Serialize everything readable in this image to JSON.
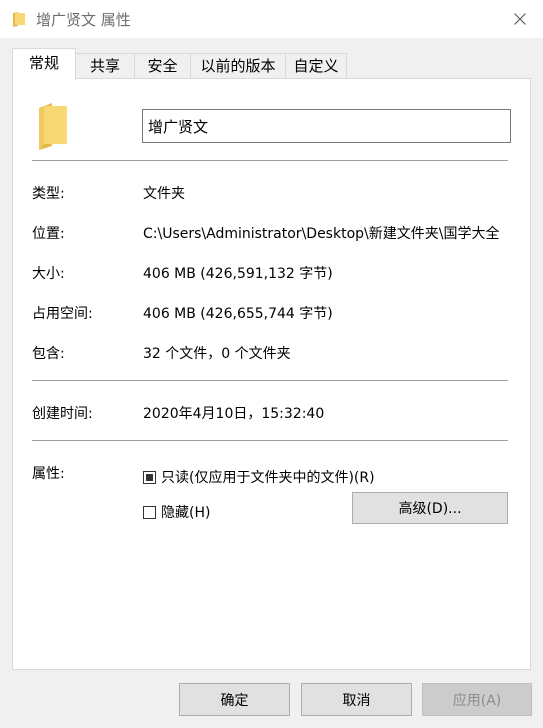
{
  "window": {
    "title": "增广贤文 属性"
  },
  "tabs": [
    {
      "label": "常规",
      "active": true
    },
    {
      "label": "共享",
      "active": false
    },
    {
      "label": "安全",
      "active": false
    },
    {
      "label": "以前的版本",
      "active": false
    },
    {
      "label": "自定义",
      "active": false
    }
  ],
  "general": {
    "folder_name": "增广贤文",
    "type_label": "类型:",
    "type_value": "文件夹",
    "location_label": "位置:",
    "location_value": "C:\\Users\\Administrator\\Desktop\\新建文件夹\\国学大全",
    "size_label": "大小:",
    "size_value": "406 MB (426,591,132 字节)",
    "size_on_disk_label": "占用空间:",
    "size_on_disk_value": "406 MB (426,655,744 字节)",
    "contains_label": "包含:",
    "contains_value": "32 个文件，0 个文件夹",
    "created_label": "创建时间:",
    "created_value": "2020年4月10日，15:32:40",
    "attributes_label": "属性:",
    "readonly_label": "只读(仅应用于文件夹中的文件)(R)",
    "readonly_state": "indeterminate",
    "hidden_label": "隐藏(H)",
    "hidden_checked": false,
    "advanced_label": "高级(D)..."
  },
  "footer": {
    "ok_label": "确定",
    "cancel_label": "取消",
    "apply_label": "应用(A)",
    "apply_enabled": false
  },
  "colors": {
    "folder": "#f8d775",
    "folder_dark": "#e6b84a",
    "window_bg": "#f0f0f0",
    "panel_bg": "#ffffff"
  }
}
